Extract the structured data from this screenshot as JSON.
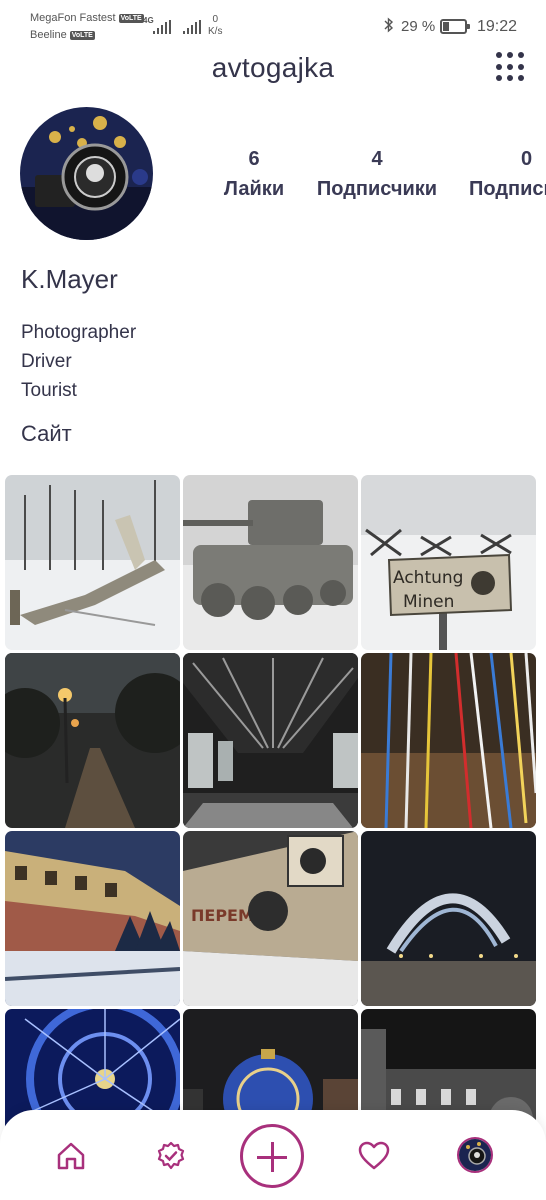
{
  "status_bar": {
    "carrier1": "MegaFon Fastest",
    "carrier2": "Beeline",
    "volte": "VoLTE",
    "network": "4G",
    "speed_value": "0",
    "speed_unit": "K/s",
    "battery_percent": "29 %",
    "battery_level": 0.29,
    "time": "19:22"
  },
  "header": {
    "username": "avtogajka",
    "menu_icon": "grid-menu-icon"
  },
  "profile": {
    "name": "K.Mayer",
    "bio": [
      "Photographer",
      "Driver",
      "Tourist"
    ],
    "site": "Сайт",
    "stats": [
      {
        "value": "6",
        "label": "Лайки"
      },
      {
        "value": "4",
        "label": "Подписчики"
      },
      {
        "value": "0",
        "label": "Подписки"
      }
    ]
  },
  "photos": [
    "snow-plane",
    "snow-tank",
    "achtung-minen-sign",
    "night-park-path",
    "underpass-tunnel",
    "light-installation",
    "kremlin-wall-night",
    "graffiti-wall",
    "illuminated-arch",
    "festive-dome",
    "christmas-ball",
    "night-building"
  ],
  "photo_texts": {
    "sign_line1": "Achtung",
    "sign_line2": "Minen",
    "graffiti": "ПЕРЕМЕН"
  },
  "nav": {
    "home_icon": "home-icon",
    "verified_icon": "verified-badge-icon",
    "add_icon": "add-icon",
    "likes_icon": "heart-icon",
    "profile_icon": "profile-avatar"
  },
  "colors": {
    "accent": "#a8307c",
    "text": "#34344a"
  }
}
